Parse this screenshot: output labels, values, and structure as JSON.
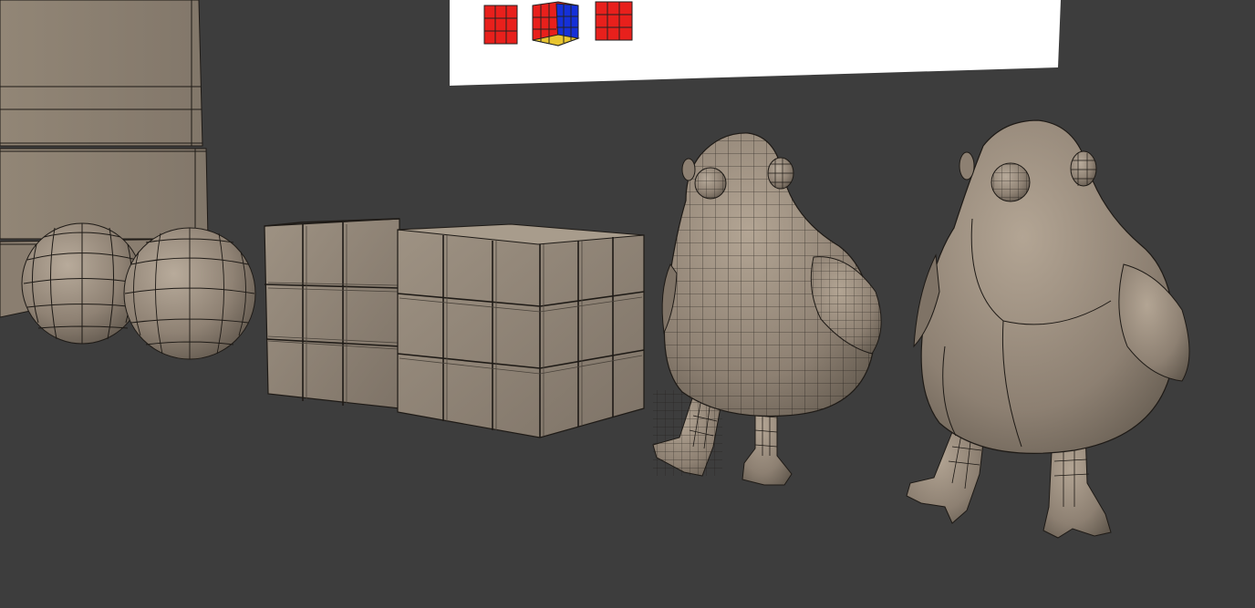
{
  "app": {
    "window_title": "",
    "view": "3D viewport"
  },
  "colors": {
    "background": "#3d3d3d",
    "model_fill": "#8f8274",
    "model_fill_light": "#a89a8a",
    "model_fill_dark": "#6e6458",
    "wire": "#1e1a16",
    "reference_panel": "#ffffff",
    "cube_red": "#e8201c",
    "cube_blue": "#1530d8",
    "cube_yellow": "#e8c530"
  },
  "scene": {
    "objects": [
      {
        "name": "reference-image-panel",
        "icons": [
          "rubiks-cube-front-icon",
          "rubiks-cube-3d-icon",
          "rubiks-cube-side-icon"
        ]
      },
      {
        "name": "box-stack"
      },
      {
        "name": "sphere-low-poly"
      },
      {
        "name": "sphere-subdivided"
      },
      {
        "name": "cube-grid-left"
      },
      {
        "name": "cube-grid-right"
      },
      {
        "name": "bird-low-poly"
      },
      {
        "name": "bird-smooth"
      }
    ]
  }
}
